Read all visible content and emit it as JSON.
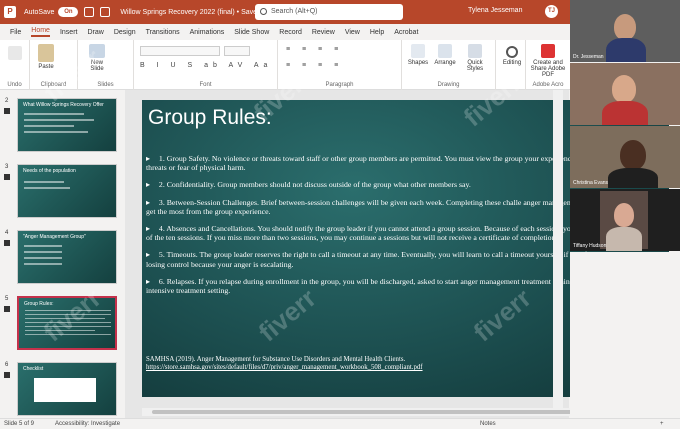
{
  "titlebar": {
    "app_icon": "powerpoint-icon",
    "autosave_label": "AutoSave",
    "autosave_state": "On",
    "doc_title": "Willow Springs Recovery 2022 (final) • Saved",
    "search_placeholder": "Search (Alt+Q)",
    "user_name": "Tylena Jesseman",
    "user_initials": "TJ"
  },
  "menu": {
    "tabs": [
      "File",
      "Home",
      "Insert",
      "Draw",
      "Design",
      "Transitions",
      "Animations",
      "Slide Show",
      "Record",
      "Review",
      "View",
      "Help",
      "Acrobat"
    ],
    "active": "Home"
  },
  "ribbon": {
    "groups": [
      {
        "label": "Undo"
      },
      {
        "label": "Clipboard"
      },
      {
        "label": "Slides"
      },
      {
        "label": "Font"
      },
      {
        "label": "Paragraph"
      },
      {
        "label": "Drawing"
      },
      {
        "label": "Adobe Acro"
      }
    ],
    "paste_label": "Paste",
    "new_slide_label": "New Slide",
    "shapes_label": "Shapes",
    "arrange_label": "Arrange",
    "quick_styles_label": "Quick Styles",
    "editing_label": "Editing",
    "create_share_label": "Create and Share Adobe PDF"
  },
  "thumbnails": [
    {
      "number": "2",
      "title": "What Willow Springs Recovery Offer"
    },
    {
      "number": "3",
      "title": "Needs of the population"
    },
    {
      "number": "4",
      "title": "\"Anger Management Group\""
    },
    {
      "number": "5",
      "title": "Group Rules:",
      "selected": true
    },
    {
      "number": "6",
      "title": "Checklist"
    }
  ],
  "slide": {
    "title": "Group Rules:",
    "bullets": [
      "1. Group Safety. No violence or threats toward staff or other group members are permitted. You must view the group your experiences and feelings without threats or fear of physical harm.",
      "2. Confidentiality. Group members should not discuss outside of the group what other members say.",
      "3. Between-Session Challenges. Brief between-session challenges will be given each week. Completing these challe anger management skills and allow you to get the most from the group experience.",
      "4. Absences and Cancellations. You should notify the group leader if you cannot attend a group session. Because of each session, you may not miss more than 2 of the ten sessions. If you miss more than two sessions, you may continue a sessions but will not receive a certificate of completion.",
      "5. Timeouts. The group leader reserves the right to call a timeout at any time. Eventually, you will learn to call a timeout yourself if you feel that you may be losing control because your anger is escalating.",
      "6. Relapses. If you relapse during enrollment in the group, you will be discharged, asked to start anger management treatment again, and referred to a more intensive treatment setting."
    ],
    "citation": "SAMHSA (2019).  Anger Management for Substance Use Disorders and Mental Health Clients.",
    "citation_link": "https://store.samhsa.gov/sites/default/files/d7/priv/anger_management_workbook_508_compliant.pdf"
  },
  "status": {
    "slide_counter": "Slide 5 of 9",
    "accessibility": "Accessibility: Investigate",
    "notes": "Notes",
    "zoom": "+"
  },
  "participants": [
    {
      "name": "Dr. Jesseman",
      "bg": "#6b6b6b"
    },
    {
      "name": "",
      "bg": "#8a7060"
    },
    {
      "name": "Christina Evans",
      "bg": "#7d6d5c"
    },
    {
      "name": "Tiffany Hudson",
      "bg": "#5a4a44"
    }
  ],
  "watermark": "fiverr",
  "colors": {
    "accent": "#b7472a",
    "selected_border": "#c4314b",
    "slide_bg": "#1b4c4d"
  }
}
